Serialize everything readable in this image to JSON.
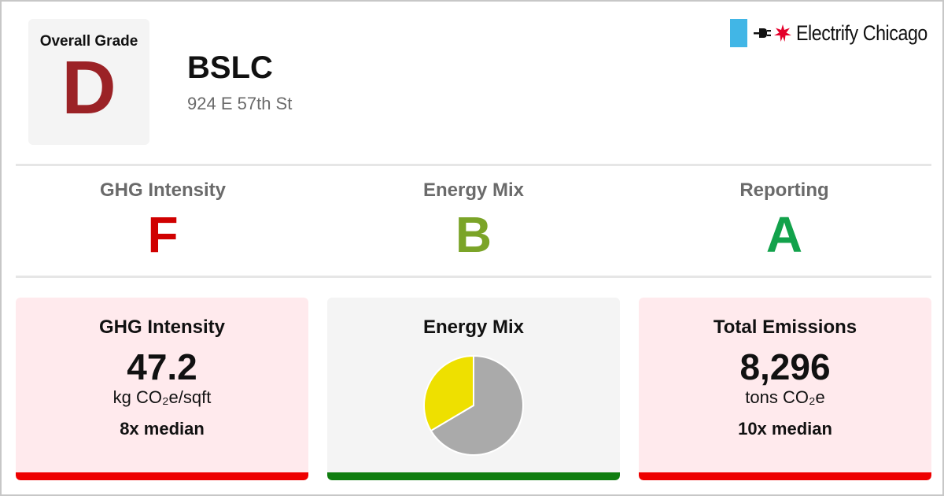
{
  "header": {
    "overall_grade_label": "Overall Grade",
    "overall_grade": "D",
    "overall_grade_color": "#9b2226",
    "building_name": "BSLC",
    "address": "924 E 57th St"
  },
  "brand": {
    "name": "Electrify Chicago",
    "flag_color": "#41b6e6",
    "star_color": "#e4002b",
    "icons": [
      "flag-bar-icon",
      "plug-icon",
      "star-icon"
    ]
  },
  "subgrades": [
    {
      "label": "GHG Intensity",
      "grade": "F",
      "color": "#d00000"
    },
    {
      "label": "Energy Mix",
      "grade": "B",
      "color": "#7ba428"
    },
    {
      "label": "Reporting",
      "grade": "A",
      "color": "#12a24b"
    }
  ],
  "cards": {
    "ghg": {
      "title": "GHG Intensity",
      "value": "47.2",
      "unit": "kg CO₂e/sqft",
      "median": "8x median",
      "bg": "#ffeaed",
      "bar": "#ee0000"
    },
    "energy": {
      "title": "Energy Mix",
      "bg": "#f4f4f4",
      "bar": "#0f7d0f"
    },
    "emissions": {
      "title": "Total Emissions",
      "value": "8,296",
      "unit": "tons CO₂e",
      "median": "10x median",
      "bg": "#ffeaed",
      "bar": "#ee0000"
    }
  },
  "chart_data": {
    "type": "pie",
    "slices": [
      {
        "fraction": 0.665,
        "color": "#aaaaaa"
      },
      {
        "fraction": 0.335,
        "color": "#eee000"
      }
    ]
  }
}
